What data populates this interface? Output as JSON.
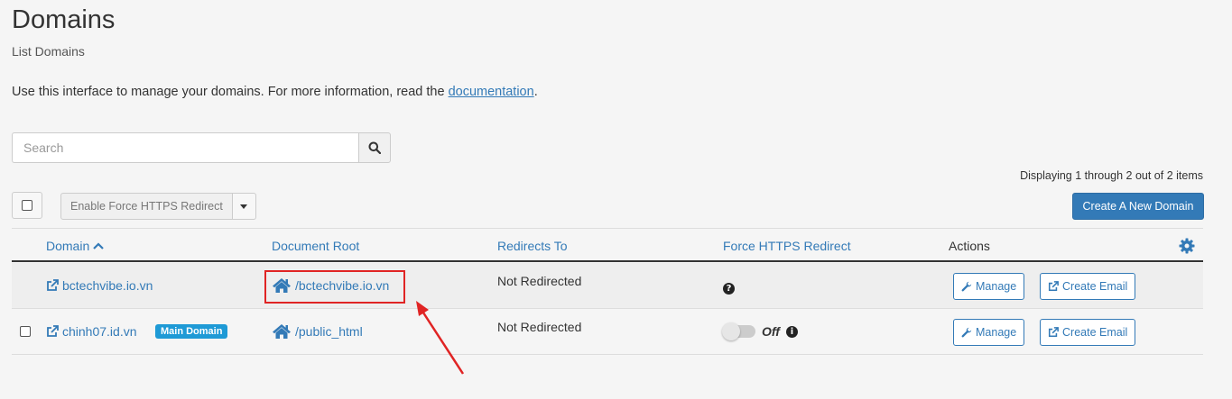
{
  "page": {
    "title": "Domains",
    "subtitle": "List Domains",
    "intro_text": "Use this interface to manage your domains. For more information, read the ",
    "intro_link": "documentation",
    "intro_end": "."
  },
  "search": {
    "placeholder": "Search",
    "value": ""
  },
  "pagination": {
    "displaying": "Displaying 1 through 2 out of 2 items"
  },
  "toolbar": {
    "bulk_action_label": "Enable Force HTTPS Redirect",
    "create_label": "Create A New Domain"
  },
  "table": {
    "headers": {
      "domain": "Domain",
      "document_root": "Document Root",
      "redirects_to": "Redirects To",
      "force_https": "Force HTTPS Redirect",
      "actions": "Actions"
    },
    "rows": [
      {
        "domain": "bctechvibe.io.vn",
        "badge": "",
        "document_root": "/bctechvibe.io.vn",
        "redirects_to": "Not Redirected",
        "force_https": "",
        "manage_label": "Manage",
        "create_email_label": "Create Email"
      },
      {
        "domain": "chinh07.id.vn",
        "badge": "Main Domain",
        "document_root": "/public_html",
        "redirects_to": "Not Redirected",
        "force_https": "Off",
        "manage_label": "Manage",
        "create_email_label": "Create Email"
      }
    ]
  },
  "colors": {
    "link": "#337ab7",
    "primary_button": "#337ab7",
    "badge": "#1e9ad6",
    "annotation": "#e02424"
  }
}
